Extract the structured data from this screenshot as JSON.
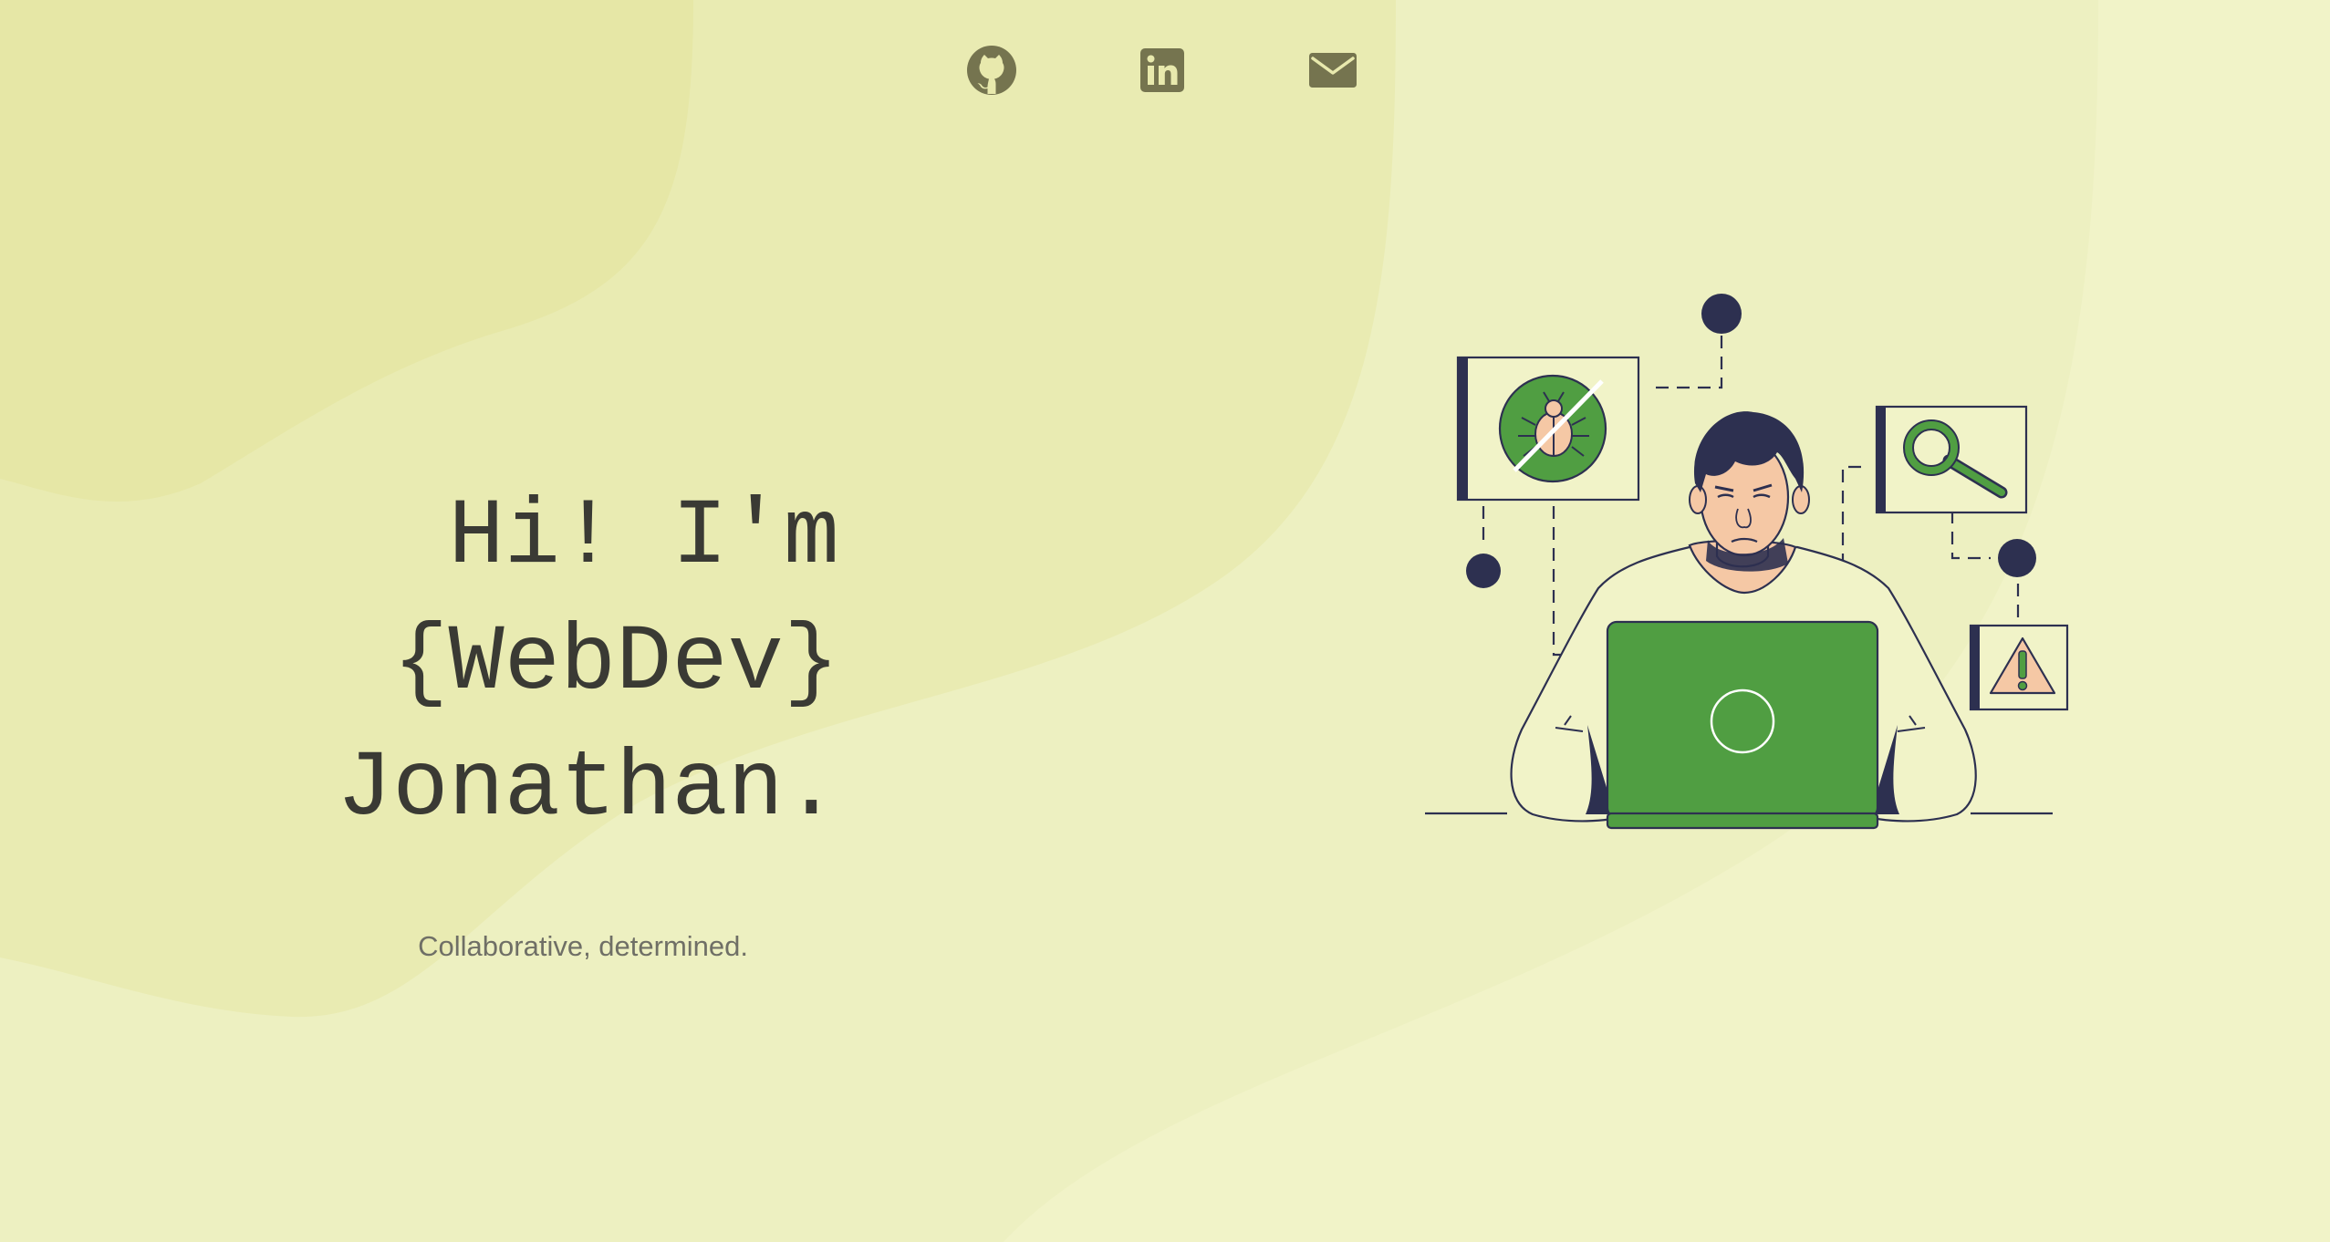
{
  "social": {
    "items": [
      {
        "name": "GitHub",
        "icon": "github-icon"
      },
      {
        "name": "LinkedIn",
        "icon": "linkedin-icon"
      },
      {
        "name": "Email",
        "icon": "mail-icon"
      }
    ],
    "icon_color": "#75744f"
  },
  "hero": {
    "line1": "Hi! I'm",
    "line2": "{WebDev}",
    "line3": "Jonathan.",
    "tagline": "Collaborative, determined."
  },
  "illustration": {
    "subject": "developer-at-laptop",
    "icons": [
      "bug-icon",
      "magnifier-icon",
      "warning-icon"
    ]
  },
  "colors": {
    "background": "#f1f3c8",
    "blob_light": "#ebeeb9",
    "blob_dark": "#e6e6a7",
    "text": "#3a3a34",
    "accent_green": "#509e42",
    "navy": "#2d3050",
    "skin": "#f5c8a5"
  }
}
